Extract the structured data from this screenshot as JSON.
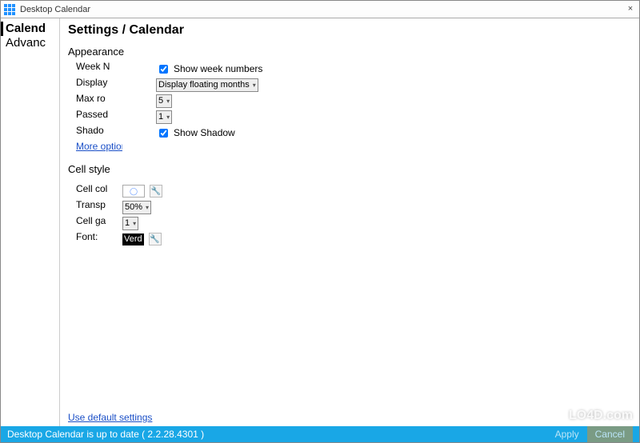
{
  "window": {
    "title": "Desktop Calendar",
    "close_glyph": "×"
  },
  "sidebar": {
    "items": [
      {
        "label": "Calend"
      },
      {
        "label": "Advanc"
      }
    ]
  },
  "page": {
    "title": "Settings / Calendar"
  },
  "appearance": {
    "heading": "Appearance",
    "labels": {
      "week_n": "Week N",
      "display": "Display",
      "max_ro": "Max ro",
      "passed": "Passed",
      "shado": "Shado"
    },
    "show_week_numbers_label": "Show week numbers",
    "show_week_numbers_checked": true,
    "display_select": "Display floating months",
    "max_rows_value": "5",
    "passed_value": "1",
    "show_shadow_label": "Show Shadow",
    "show_shadow_checked": true,
    "more_options_link": "More options..."
  },
  "cellstyle": {
    "heading": "Cell style",
    "labels": {
      "cell_col": "Cell col",
      "transp": "Transp",
      "cell_ga": "Cell ga",
      "font": "Font:"
    },
    "swatch_glyph": "◯",
    "transp_value": "50%",
    "cell_gap_value": "1",
    "font_value": "Verd",
    "wrench_glyph": "🔧"
  },
  "links": {
    "use_default": "Use default settings"
  },
  "statusbar": {
    "text": "Desktop Calendar is up to date ( 2.2.28.4301 )",
    "apply": "Apply",
    "cancel": "Cancel"
  },
  "watermark": {
    "text": "LO4D.com"
  }
}
